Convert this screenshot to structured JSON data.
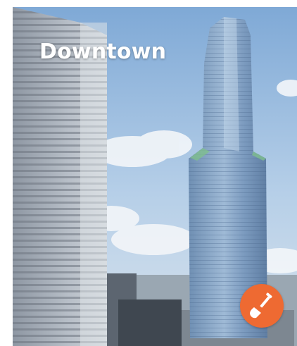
{
  "card": {
    "title": "Downtown",
    "badge_icon": "shovel-icon",
    "accent_color": "#ee6a32"
  }
}
